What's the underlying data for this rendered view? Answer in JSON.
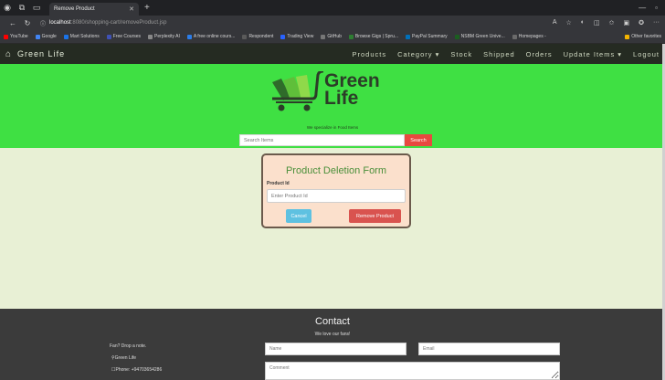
{
  "browser": {
    "tab_title": "Remove Product",
    "url_host": "localhost",
    "url_path": ":8080/shopping-cart/removeProduct.jsp",
    "bookmarks": [
      "YouTube",
      "Google",
      "Mart Solutions",
      "Free Courses",
      "Perplexity AI",
      "A free online cours...",
      "Respondent",
      "Trading View",
      "GitHub",
      "Browse Gigs | Spru...",
      "PayPal Summary",
      "NSBM Green Unive...",
      "Homepages -"
    ],
    "other_favorites": "Other favorites"
  },
  "navbar": {
    "brand": "Green Life",
    "menu": [
      "Products",
      "Category ▾",
      "Stock",
      "Shipped",
      "Orders",
      "Update Items ▾",
      "Logout"
    ]
  },
  "hero": {
    "logo_line1": "Green",
    "logo_line2": "Life",
    "tagline": "We specialize in Food Items",
    "search_placeholder": "Search Items",
    "search_button": "Search"
  },
  "form": {
    "title": "Product Deletion Form",
    "label": "Product Id",
    "placeholder": "Enter Product Id",
    "cancel": "Cancel",
    "remove": "Remove Product"
  },
  "footer": {
    "title": "Contact",
    "subtitle": "We love our fans!",
    "fan_note": "Fan? Drop a note.",
    "name_line": "Green Life",
    "phone_line": "Phone: +94703654286",
    "name_placeholder": "Name",
    "email_placeholder": "Email",
    "comment_placeholder": "Comment"
  },
  "colors": {
    "hero_green": "#3fe043",
    "page_bg": "#e8f0d5",
    "navbar": "#252b22",
    "accent_red": "#e8493f",
    "cancel_blue": "#5ec1e1",
    "footer": "#3b3b3b"
  }
}
